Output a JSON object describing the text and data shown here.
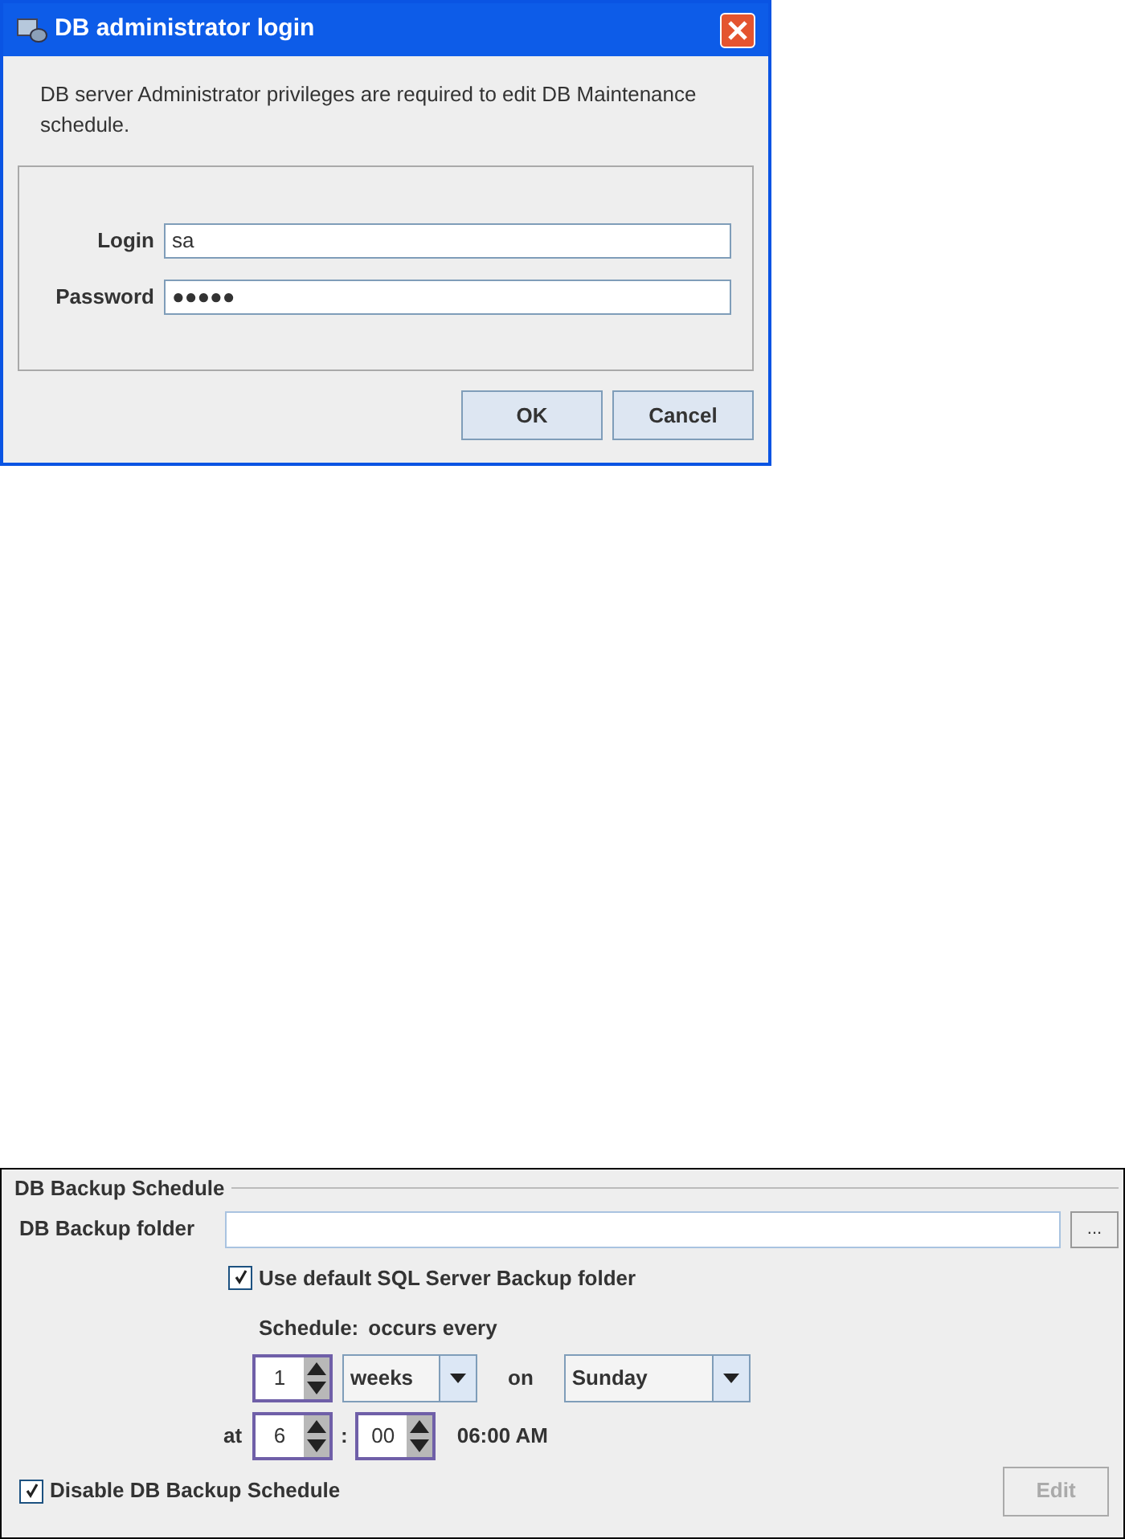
{
  "dialog": {
    "title": "DB administrator login",
    "message": "DB server Administrator privileges are required to edit DB Maintenance schedule.",
    "fields": [
      {
        "label": "Login",
        "value": "sa"
      },
      {
        "label": "Password",
        "value": "●●●●●"
      }
    ],
    "buttons": [
      "OK",
      "Cancel"
    ]
  },
  "backup_panel": {
    "title": "DB Backup Schedule",
    "folder_label": "DB Backup folder",
    "browse_button": "...",
    "use_default": {
      "label": "Use default SQL Server Backup folder",
      "checked": true
    },
    "schedule_label": "Schedule:",
    "occurs_label": "occurs every",
    "interval": "1",
    "unit": "weeks",
    "on_label": "on",
    "day": "Sunday",
    "at_label": "at",
    "hour": "6",
    "separator": ":",
    "minute": "00",
    "time_text": "06:00 AM",
    "disable": {
      "label": "Disable DB Backup Schedule",
      "checked": true
    },
    "edit_button": {
      "label": "Edit",
      "disabled": true
    }
  }
}
